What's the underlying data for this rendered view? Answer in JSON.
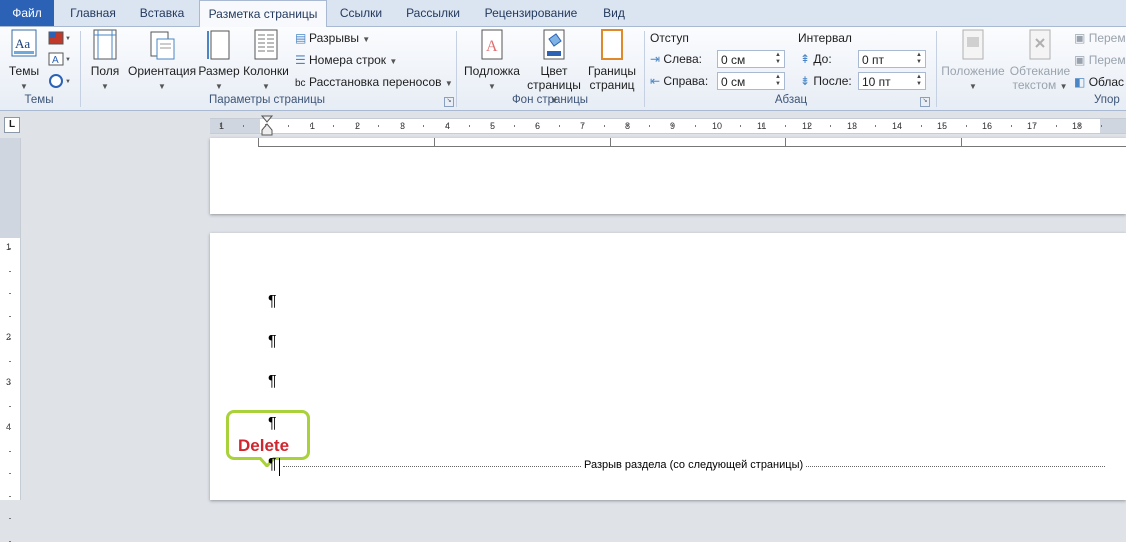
{
  "tabs": {
    "file": "Файл",
    "home": "Главная",
    "insert": "Вставка",
    "layout": "Разметка страницы",
    "refs": "Ссылки",
    "mail": "Рассылки",
    "review": "Рецензирование",
    "view": "Вид"
  },
  "groups": {
    "themes": {
      "label": "Темы",
      "themes_btn": "Темы"
    },
    "page_setup": {
      "label": "Параметры страницы",
      "margins": "Поля",
      "orientation": "Ориентация",
      "size": "Размер",
      "columns": "Колонки",
      "breaks": "Разрывы",
      "line_numbers": "Номера строк",
      "hyphenation": "Расстановка переносов"
    },
    "background": {
      "label": "Фон страницы",
      "watermark": "Подложка",
      "page_color_1": "Цвет",
      "page_color_2": "страницы",
      "borders_1": "Границы",
      "borders_2": "страниц"
    },
    "paragraph": {
      "label": "Абзац",
      "indent": "Отступ",
      "left_label": "Слева:",
      "left_value": "0 см",
      "right_label": "Справа:",
      "right_value": "0 см",
      "spacing": "Интервал",
      "before_label": "До:",
      "before_value": "0 пт",
      "after_label": "После:",
      "after_value": "10 пт"
    },
    "arrange": {
      "label": "Упор",
      "position": "Положение",
      "wrap_1": "Обтекание",
      "wrap_2": "текстом",
      "forward": "Перем",
      "backward": "Перем",
      "pane": "Облас"
    }
  },
  "ruler": {
    "h_numbers": [
      "1",
      "1",
      "2",
      "3",
      "4",
      "5",
      "6",
      "7",
      "8",
      "9",
      "10",
      "11",
      "12",
      "13",
      "14",
      "15",
      "16",
      "17",
      "18"
    ],
    "v_numbers": [
      "1",
      "2",
      "3",
      "4"
    ]
  },
  "document": {
    "pilcrow": "¶",
    "annotation": "Delete",
    "section_break": "Разрыв раздела (со следующей страницы)"
  },
  "colors": {
    "accent": "#2b62b6",
    "callout_border": "#a9d13a",
    "callout_text": "#d0262f"
  }
}
